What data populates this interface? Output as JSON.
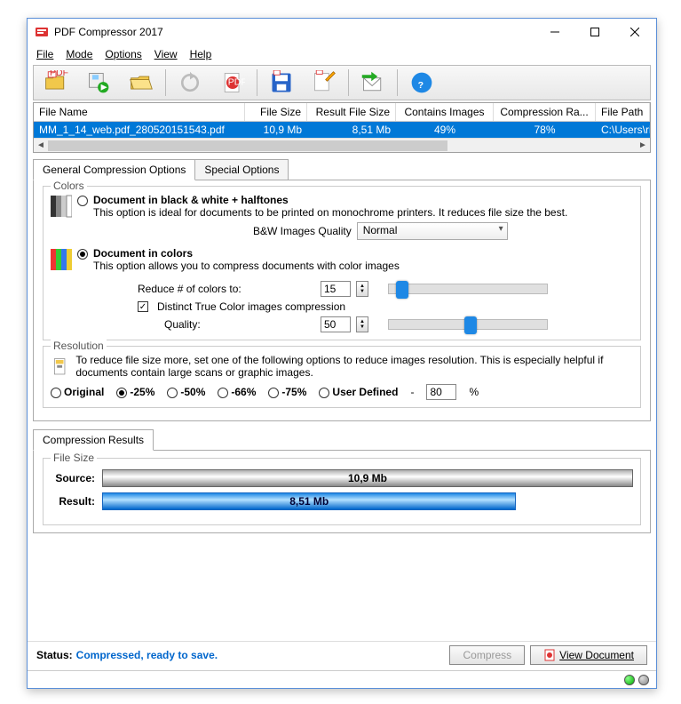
{
  "app": {
    "title": "PDF Compressor 2017"
  },
  "menu": {
    "file": "File",
    "mode": "Mode",
    "options": "Options",
    "view": "View",
    "help": "Help"
  },
  "grid": {
    "headers": {
      "name": "File Name",
      "size": "File Size",
      "rsize": "Result File Size",
      "img": "Contains Images",
      "ratio": "Compression Ra...",
      "path": "File Path"
    },
    "row": {
      "name": "MM_1_14_web.pdf_280520151543.pdf",
      "size": "10,9 Mb",
      "rsize": "8,51 Mb",
      "img": "49%",
      "ratio": "78%",
      "path": "C:\\Users\\rio_su"
    }
  },
  "tabs": {
    "general": "General Compression Options",
    "special": "Special Options"
  },
  "colors": {
    "legend": "Colors",
    "bw_title": "Document in black & white + halftones",
    "bw_desc": "This option is ideal for documents to be printed on monochrome printers. It reduces file size the best.",
    "bw_quality_label": "B&W Images Quality",
    "bw_quality_value": "Normal",
    "color_title": "Document in colors",
    "color_desc": "This option allows you to compress documents with color images",
    "reduce_label": "Reduce # of colors to:",
    "reduce_value": "15",
    "distinct_label": "Distinct True Color images compression",
    "quality_label": "Quality:",
    "quality_value": "50"
  },
  "resolution": {
    "legend": "Resolution",
    "desc": "To reduce file size more, set one of the following options to reduce images resolution. This is especially helpful if documents contain large scans or graphic images.",
    "opts": {
      "orig": "Original",
      "p25": "-25%",
      "p50": "-50%",
      "p66": "-66%",
      "p75": "-75%",
      "user": "User Defined"
    },
    "user_value": "80",
    "pct": "%"
  },
  "results": {
    "tab": "Compression Results",
    "legend": "File Size",
    "source_label": "Source:",
    "source_value": "10,9 Mb",
    "result_label": "Result:",
    "result_value": "8,51 Mb"
  },
  "bottom": {
    "status_label": "Status:",
    "status_value": "Compressed, ready to save.",
    "compress": "Compress",
    "view": "View Document"
  }
}
